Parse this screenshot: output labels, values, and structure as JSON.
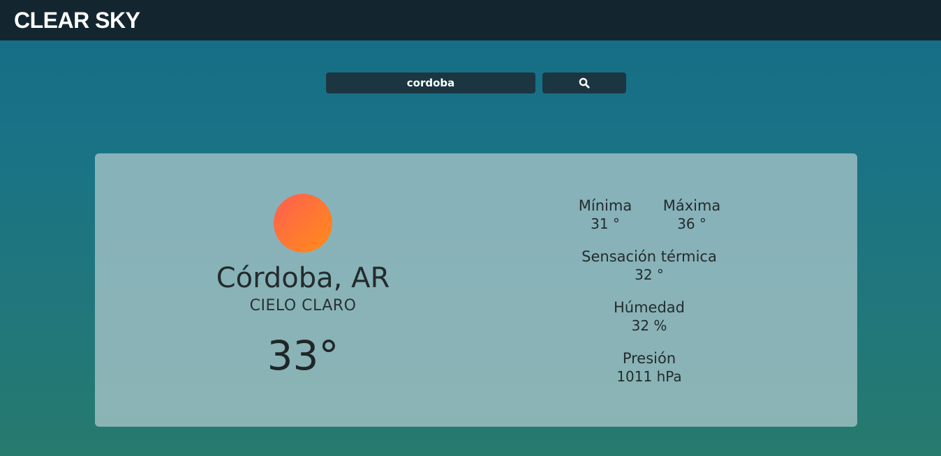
{
  "header": {
    "brand": "CLEAR SKY"
  },
  "search": {
    "value": "cordoba",
    "button_icon": "search-icon"
  },
  "weather": {
    "icon": "sun-icon",
    "city": "Córdoba, AR",
    "description": "CIELO CLARO",
    "temperature": "33°",
    "min_label": "Mínima",
    "min_value": "31 °",
    "max_label": "Máxima",
    "max_value": "36 °",
    "feels_label": "Sensación térmica",
    "feels_value": "32 °",
    "humidity_label": "Húmedad",
    "humidity_value": "32 %",
    "pressure_label": "Presión",
    "pressure_value": "1011 hPa"
  },
  "colors": {
    "header_bg": "#13262f",
    "input_bg": "#1b3641",
    "sun_start": "#ff5c52",
    "sun_end": "#ff8c1a"
  }
}
